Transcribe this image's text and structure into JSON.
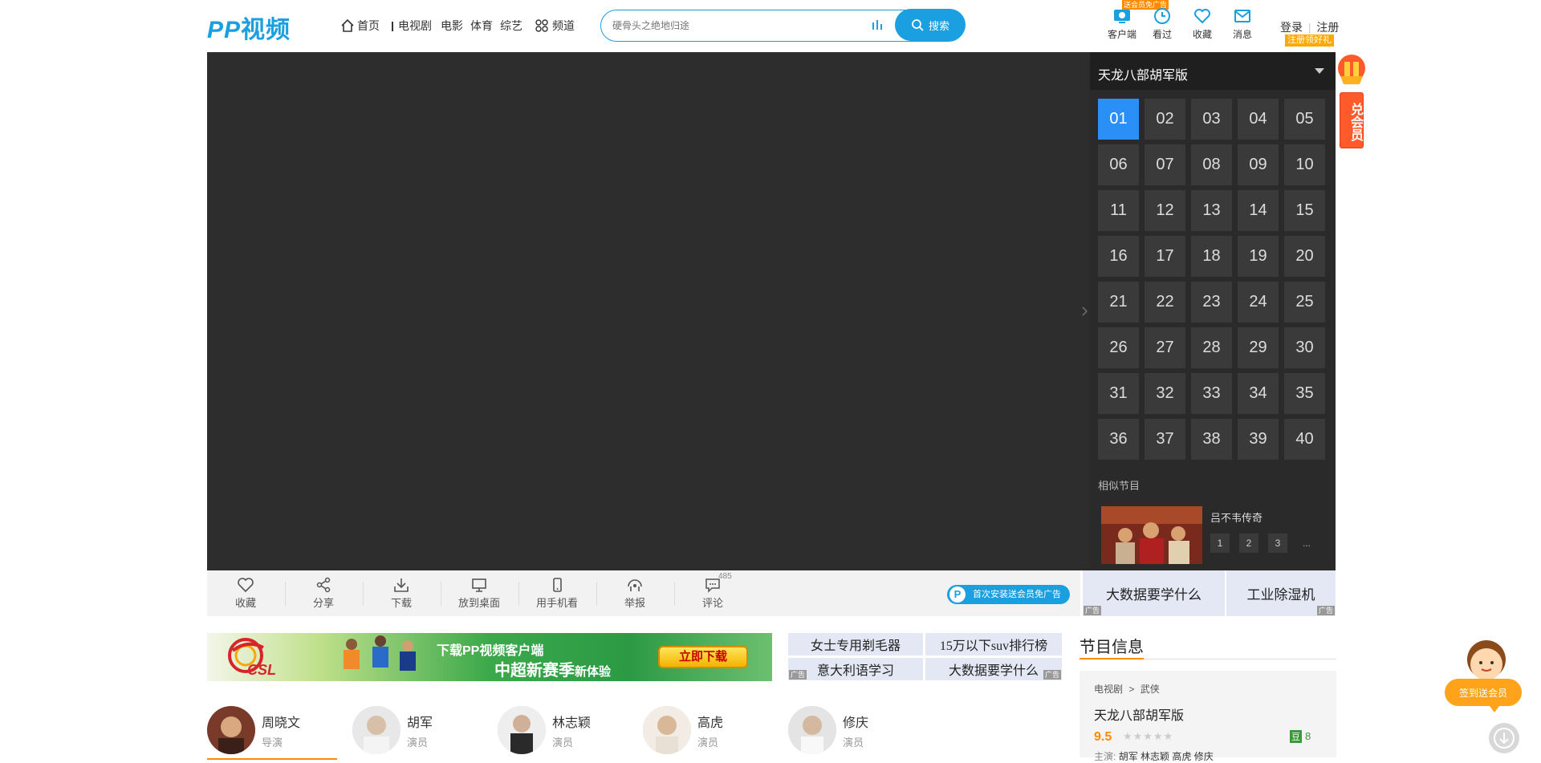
{
  "header": {
    "logo_letters": "PP",
    "logo_text": "视频",
    "nav": {
      "home": "首页",
      "tv": "电视剧",
      "movie": "电影",
      "sports": "体育",
      "variety": "综艺",
      "channels": "频道"
    },
    "search": {
      "placeholder": "硬骨头之绝地归途",
      "button": "搜索"
    },
    "tools": {
      "client": "客户端",
      "history": "看过",
      "favorites": "收藏",
      "messages": "消息",
      "client_tag": "送会员免广告"
    },
    "login": "登录",
    "register": "注册",
    "register_tag": "注册领好礼"
  },
  "playlist": {
    "title": "天龙八部胡军版",
    "episodes": [
      "01",
      "02",
      "03",
      "04",
      "05",
      "06",
      "07",
      "08",
      "09",
      "10",
      "11",
      "12",
      "13",
      "14",
      "15",
      "16",
      "17",
      "18",
      "19",
      "20",
      "21",
      "22",
      "23",
      "24",
      "25",
      "26",
      "27",
      "28",
      "29",
      "30",
      "31",
      "32",
      "33",
      "34",
      "35",
      "36",
      "37",
      "38",
      "39",
      "40"
    ],
    "active_episode": "01",
    "similar_title": "相似节目",
    "similar_show": {
      "name": "吕不韦传奇",
      "eps": [
        "1",
        "2",
        "3",
        "..."
      ]
    }
  },
  "vip_side": {
    "text": "兑会员"
  },
  "toolbar": {
    "favorite": "收藏",
    "share": "分享",
    "download": "下载",
    "desktop": "放到桌面",
    "mobile": "用手机看",
    "report": "举报",
    "comment": "评论",
    "comment_count": "485",
    "install_pill": "首次安装送会员免广告",
    "ads": [
      "大数据要学什么",
      "工业除湿机"
    ],
    "ad_tag": "广告"
  },
  "banner": {
    "line1": "下载PP视频客户端",
    "line2": "中超新赛季",
    "line2_small": "新体验",
    "button": "立即下载",
    "logo_text": "CSL"
  },
  "keywords": [
    "女士专用剃毛器",
    "15万以下suv排行榜",
    "意大利语学习",
    "大数据要学什么"
  ],
  "info": {
    "title": "节目信息",
    "crumb_category": "电视剧",
    "crumb_sep": ">",
    "crumb_genre": "武侠",
    "show_title": "天龙八部胡军版",
    "score": "9.5",
    "stars": "★★★★★",
    "douban_icon": "豆",
    "douban_score": "8",
    "cast_label": "主演:",
    "cast_names": "胡军  林志颖  高虎  修庆"
  },
  "people": [
    {
      "name": "周晓文",
      "role": "导演"
    },
    {
      "name": "胡军",
      "role": "演员"
    },
    {
      "name": "林志颖",
      "role": "演员"
    },
    {
      "name": "高虎",
      "role": "演员"
    },
    {
      "name": "修庆",
      "role": "演员"
    }
  ],
  "signin": {
    "label": "签到送会员"
  },
  "colors": {
    "brand": "#1a9fe0",
    "accent": "#ff8a00",
    "active_episode": "#2a8ff7",
    "player_bg": "#2d2d2d"
  }
}
